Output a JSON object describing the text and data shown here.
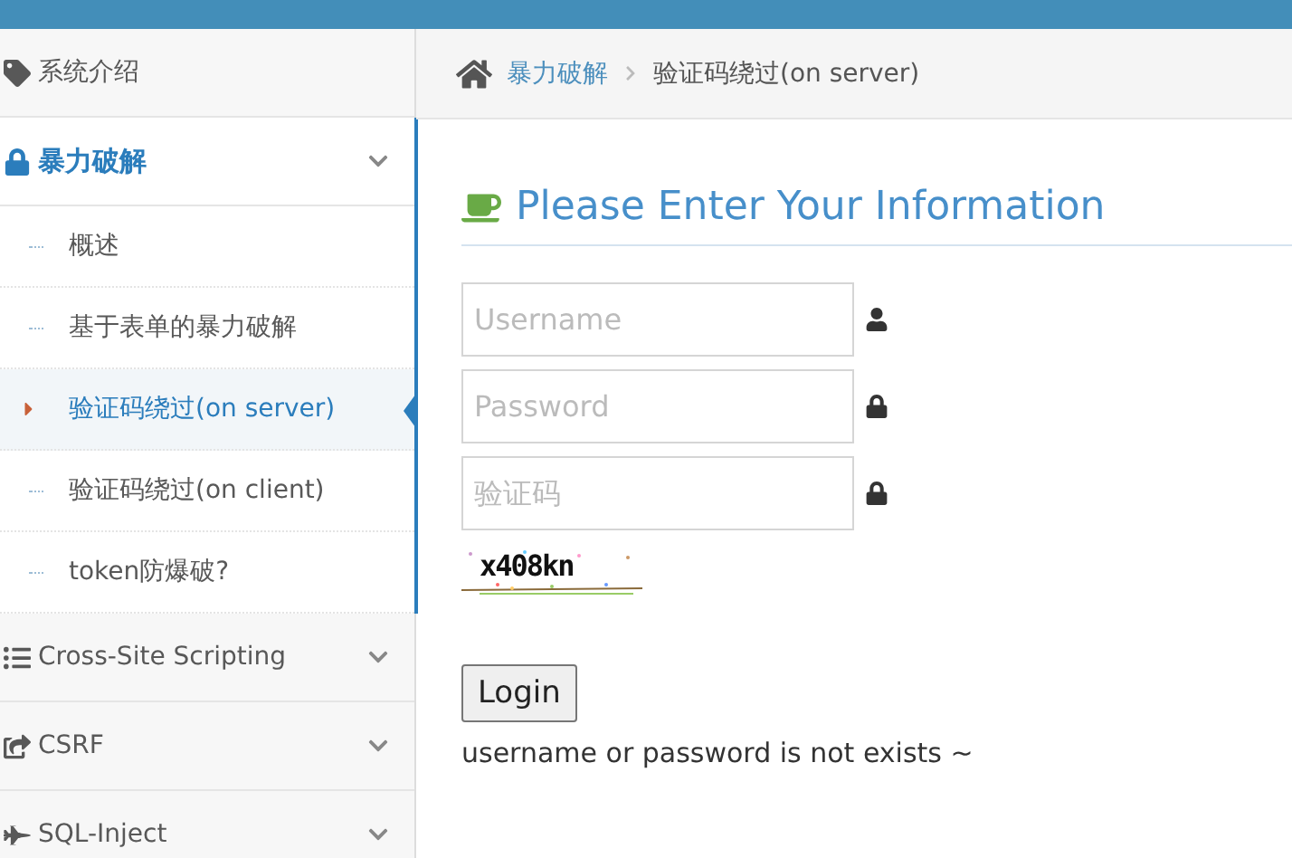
{
  "sidebar": {
    "sections": [
      {
        "kind": "link",
        "label": "系统介绍",
        "selected": false
      },
      {
        "kind": "menu",
        "label": "暴力破解",
        "selected": true,
        "expanded": true,
        "children": [
          {
            "label": "概述",
            "selected": false
          },
          {
            "label": "基于表单的暴力破解",
            "selected": false
          },
          {
            "label": "验证码绕过(on server)",
            "selected": true
          },
          {
            "label": "验证码绕过(on client)",
            "selected": false
          },
          {
            "label": "token防爆破?",
            "selected": false
          }
        ]
      },
      {
        "kind": "menu",
        "label": "Cross-Site Scripting",
        "selected": false
      },
      {
        "kind": "menu",
        "label": "CSRF",
        "selected": false
      },
      {
        "kind": "menu",
        "label": "SQL-Inject",
        "selected": false
      }
    ]
  },
  "breadcrumb": [
    "暴力破解",
    "验证码绕过(on server)"
  ],
  "form": {
    "title": "Please Enter Your Information",
    "fields": [
      {
        "kind": "user",
        "placeholder": "Username"
      },
      {
        "kind": "lock",
        "placeholder": "Password"
      },
      {
        "kind": "lock",
        "placeholder": "验证码"
      }
    ],
    "captcha": "x408kn",
    "button": "Login",
    "message": "username or password is not exists ~"
  }
}
